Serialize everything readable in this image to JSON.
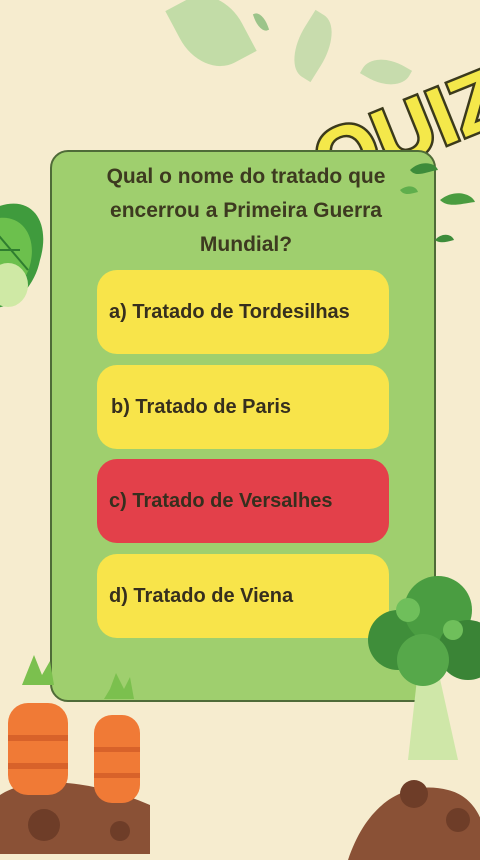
{
  "badge": {
    "text": "QUIZ"
  },
  "question": {
    "text": "Qual o nome do tratado que encerrou a Primeira Guerra Mundial?"
  },
  "options": [
    {
      "label": "a) Tratado de Tordesilhas",
      "state": "default"
    },
    {
      "label": "b) Tratado de Paris",
      "state": "default"
    },
    {
      "label": "c) Tratado de Versalhes",
      "state": "highlighted"
    },
    {
      "label": "d) Tratado de Viena",
      "state": "default"
    }
  ],
  "colors": {
    "background": "#f6eccf",
    "card": "#9fcf6e",
    "option_default": "#f8e44a",
    "option_highlighted": "#e3404a",
    "text": "#362f1e",
    "badge_fill": "#f4e84a"
  },
  "icons": [
    "leaf-icon",
    "quiz-badge",
    "broccoli-icon",
    "carrot-icon"
  ]
}
